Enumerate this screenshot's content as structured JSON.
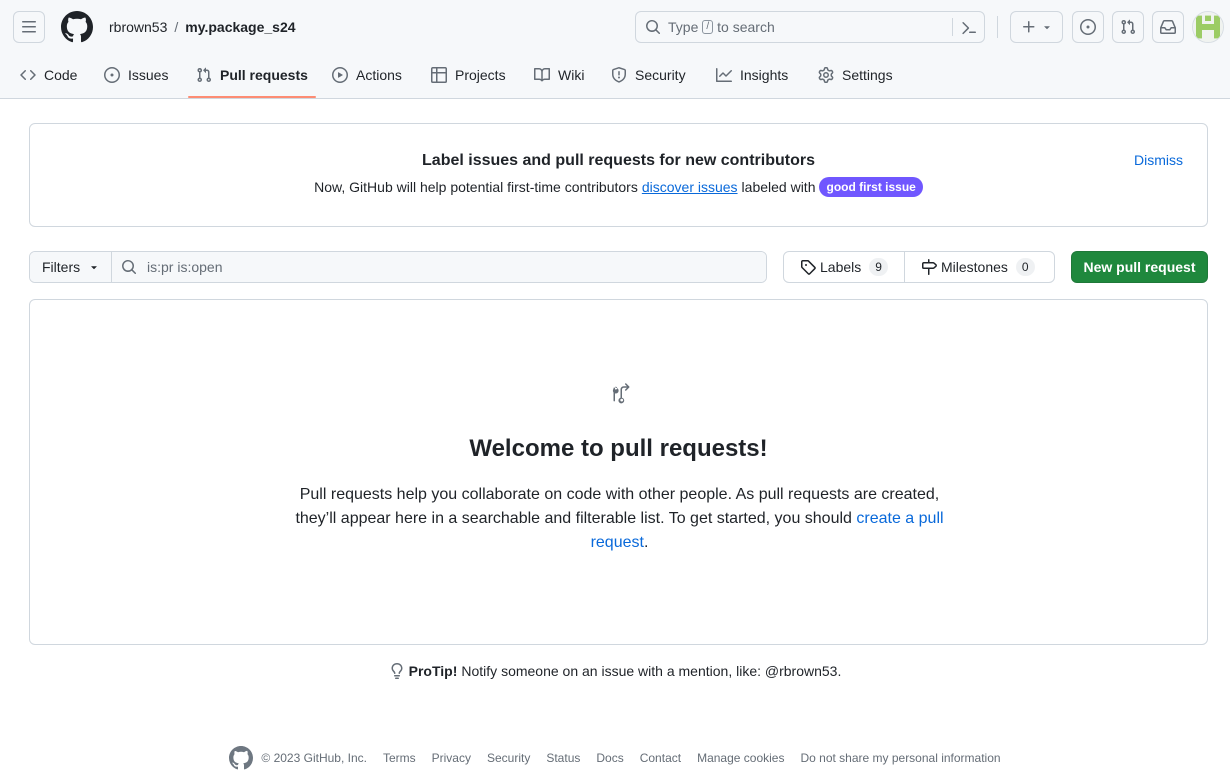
{
  "header": {
    "owner": "rbrown53",
    "separator": "/",
    "repo": "my.package_s24",
    "search": {
      "prefix": "Type",
      "key": "/",
      "suffix": "to search"
    }
  },
  "repo_nav": {
    "items": [
      {
        "label": "Code",
        "icon": "code-icon"
      },
      {
        "label": "Issues",
        "icon": "issue-opened-icon"
      },
      {
        "label": "Pull requests",
        "icon": "git-pull-request-icon",
        "active": true
      },
      {
        "label": "Actions",
        "icon": "play-icon"
      },
      {
        "label": "Projects",
        "icon": "table-icon"
      },
      {
        "label": "Wiki",
        "icon": "book-icon"
      },
      {
        "label": "Security",
        "icon": "shield-icon"
      },
      {
        "label": "Insights",
        "icon": "graph-icon"
      },
      {
        "label": "Settings",
        "icon": "gear-icon"
      }
    ]
  },
  "banner": {
    "title": "Label issues and pull requests for new contributors",
    "text_before": "Now, GitHub will help potential first-time contributors",
    "link": "discover issues",
    "text_after": "labeled with",
    "label": "good first issue",
    "label_color": "#7057ff",
    "dismiss": "Dismiss"
  },
  "toolbar": {
    "filters": "Filters",
    "filter_value": "is:pr is:open",
    "labels": "Labels",
    "labels_count": "9",
    "milestones": "Milestones",
    "milestones_count": "0",
    "new_pr": "New pull request",
    "new_pr_color": "#1f883d"
  },
  "blankslate": {
    "title": "Welcome to pull requests!",
    "text_before": "Pull requests help you collaborate on code with other people. As pull requests are created, they’ll appear here in a searchable and filterable list. To get started, you should",
    "link": "create a pull request",
    "text_after": "."
  },
  "protip": {
    "label": "ProTip!",
    "text": "Notify someone on an issue with a mention, like: @rbrown53."
  },
  "footer": {
    "copyright": "© 2023 GitHub, Inc.",
    "links": [
      "Terms",
      "Privacy",
      "Security",
      "Status",
      "Docs",
      "Contact",
      "Manage cookies",
      "Do not share my personal information"
    ]
  }
}
